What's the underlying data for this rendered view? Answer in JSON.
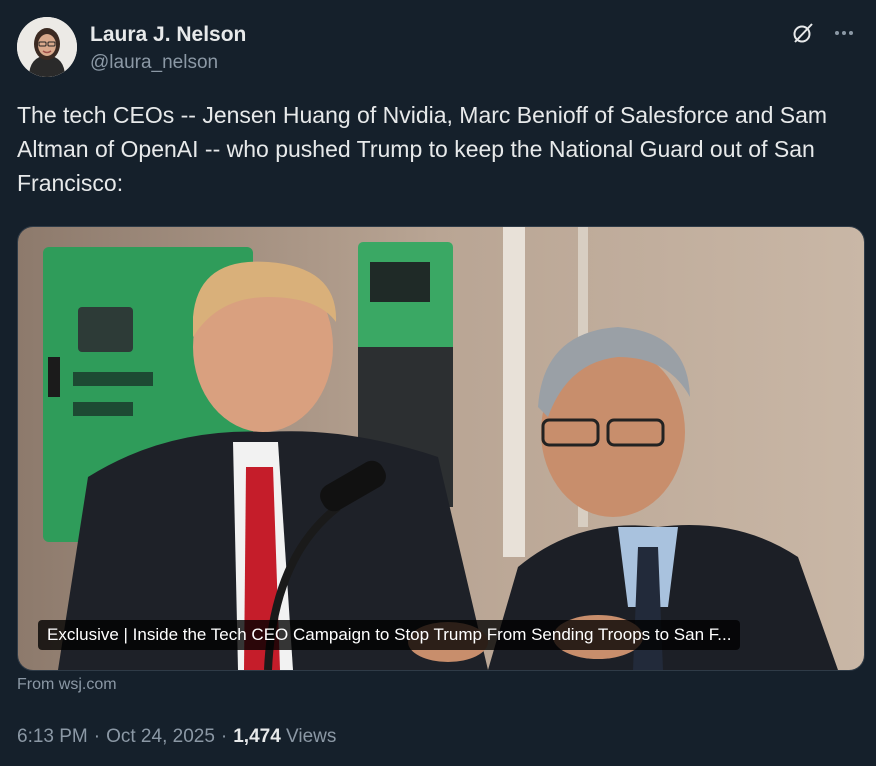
{
  "author": {
    "display_name": "Laura J. Nelson",
    "handle": "@laura_nelson",
    "avatar_icon": "profile-photo"
  },
  "header_icons": [
    "grok-icon",
    "more-icon"
  ],
  "tweet": {
    "text": "The tech CEOs -- Jensen Huang of Nvidia, Marc Benioff of Salesforce and Sam Altman of OpenAI -- who pushed Trump to keep the National Guard out of San Francisco:"
  },
  "card": {
    "caption": "Exclusive | Inside the Tech CEO Campaign to Stop Trump From Sending Troops to San F...",
    "source": "From wsj.com"
  },
  "meta": {
    "time": "6:13 PM",
    "date": "Oct 24, 2025",
    "views_count": "1,474",
    "views_label": "Views"
  },
  "colors": {
    "background": "#15202b",
    "text_primary": "#e7e9ea",
    "text_secondary": "#8b98a5"
  }
}
